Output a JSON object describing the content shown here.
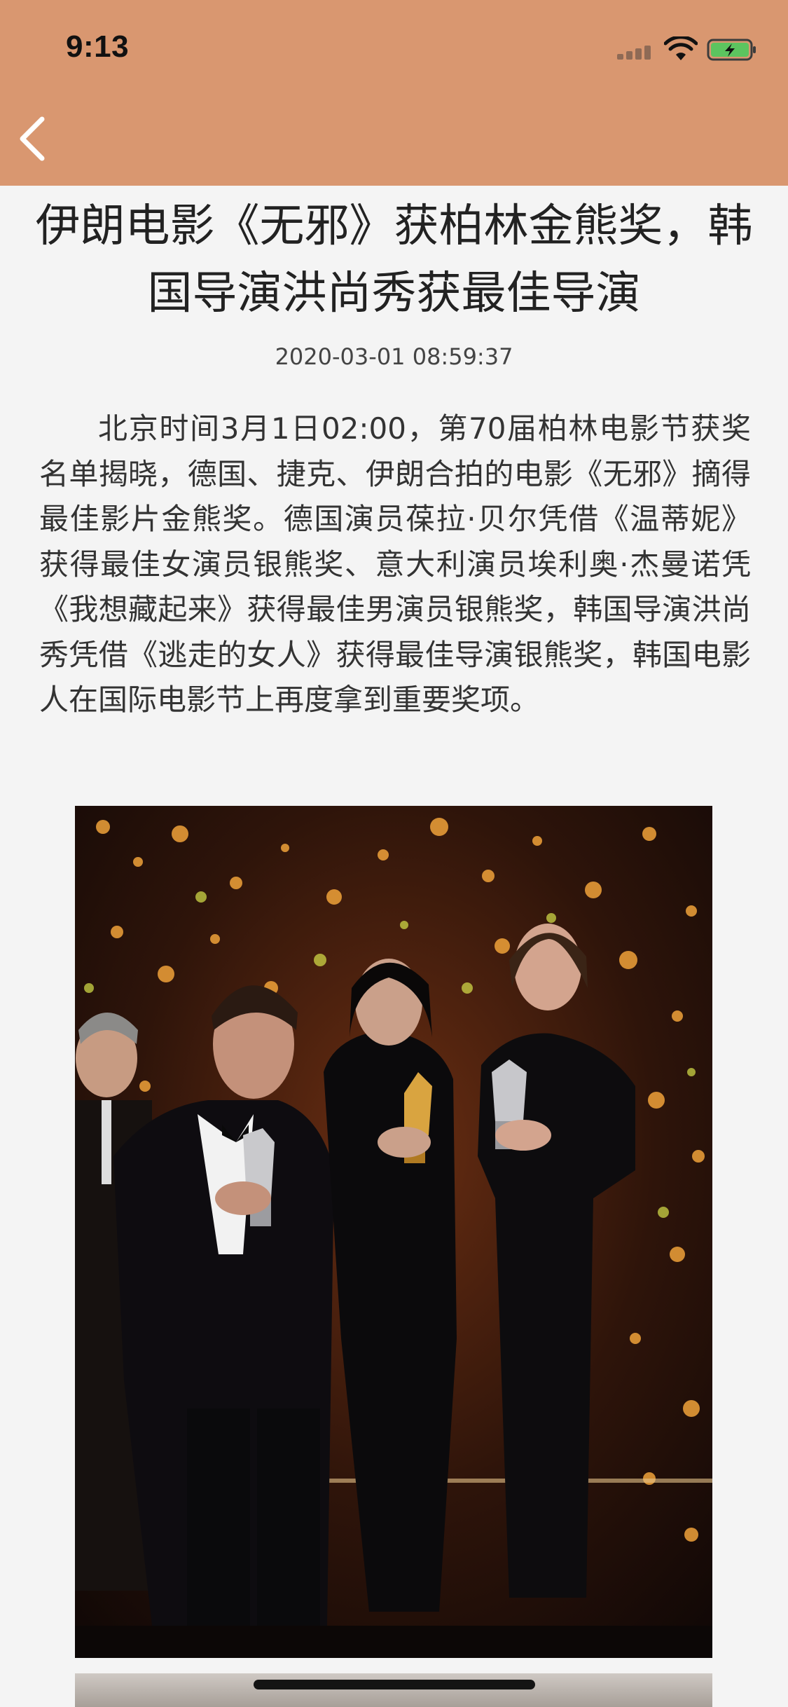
{
  "status_bar": {
    "time": "9:13"
  },
  "nav": {
    "back_icon": "chevron-left-icon"
  },
  "article": {
    "title": "伊朗电影《无邪》获柏林金熊奖，韩国导演洪尚秀获最佳导演",
    "date": "2020-03-01 08:59:37",
    "body": "北京时间3月1日02:00，第70届柏林电影节获奖名单揭晓，德国、捷克、伊朗合拍的电影《无邪》摘得最佳影片金熊奖。德国演员葆拉·贝尔凭借《温蒂妮》获得最佳女演员银熊奖、意大利演员埃利奥·杰曼诺凭《我想藏起来》获得最佳男演员银熊奖，韩国导演洪尚秀凭借《逃走的女人》获得最佳导演银熊奖，韩国电影人在国际电影节上再度拿到重要奖项。"
  },
  "colors": {
    "header_bg": "#d99770",
    "page_bg": "#f4f4f4",
    "battery_fill": "#5cc45f"
  }
}
